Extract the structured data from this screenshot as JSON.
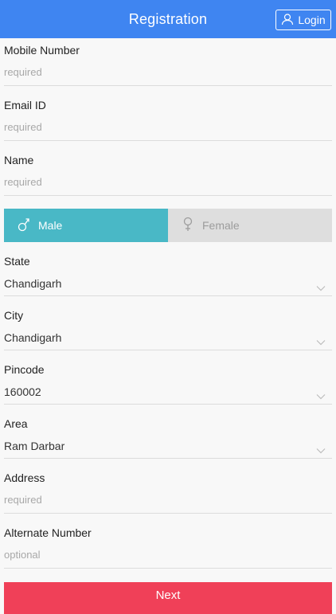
{
  "header": {
    "title": "Registration",
    "login_label": "Login",
    "color": "#3f85f1"
  },
  "fields": {
    "mobile": {
      "label": "Mobile Number",
      "placeholder": "required"
    },
    "email": {
      "label": "Email ID",
      "placeholder": "required"
    },
    "name": {
      "label": "Name",
      "placeholder": "required"
    },
    "state": {
      "label": "State",
      "value": "Chandigarh"
    },
    "city": {
      "label": "City",
      "value": "Chandigarh"
    },
    "pincode": {
      "label": "Pincode",
      "value": "160002"
    },
    "area": {
      "label": "Area",
      "value": "Ram Darbar"
    },
    "address": {
      "label": "Address",
      "placeholder": "required"
    },
    "alternate": {
      "label": "Alternate Number",
      "placeholder": "optional"
    }
  },
  "gender": {
    "male_label": "Male",
    "female_label": "Female",
    "selected": "Male",
    "active_color": "#49b8c6",
    "inactive_color": "#dedede"
  },
  "actions": {
    "next_label": "Next",
    "next_color": "#f04058"
  },
  "icons": {
    "login": "user-icon",
    "male": "male-symbol-icon",
    "female": "female-symbol-icon",
    "dropdown": "chevron-down-icon"
  }
}
